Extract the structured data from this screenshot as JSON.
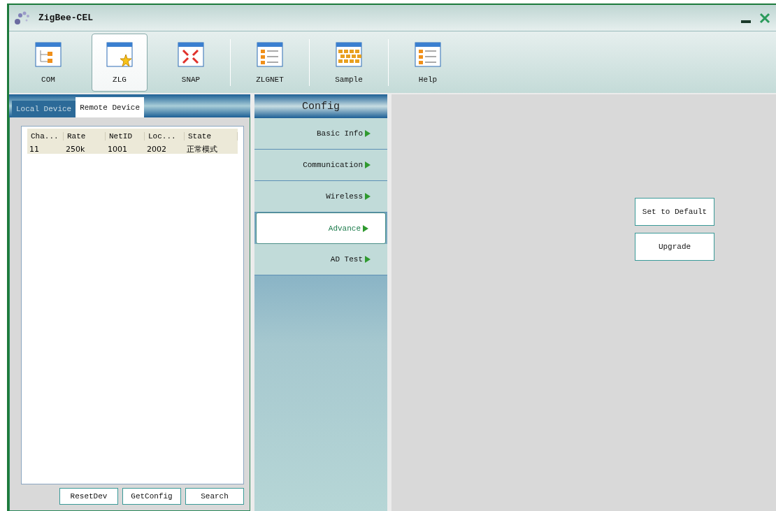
{
  "window": {
    "title": "ZigBee-CEL"
  },
  "toolbar": [
    {
      "label": "COM",
      "kind": "tree",
      "selected": false
    },
    {
      "label": "ZLG",
      "kind": "star",
      "selected": true
    },
    {
      "label": "SNAP",
      "kind": "arrows",
      "selected": false
    },
    {
      "label": "ZLGNET",
      "kind": "list",
      "selected": false
    },
    {
      "label": "Sample",
      "kind": "grid",
      "selected": false
    },
    {
      "label": "Help",
      "kind": "list",
      "selected": false
    }
  ],
  "device_tabs": [
    {
      "label": "Local Device",
      "selected": false
    },
    {
      "label": "Remote Device",
      "selected": true
    }
  ],
  "device_list": {
    "columns": [
      "Cha...",
      "Rate",
      "NetID",
      "Loc...",
      "State"
    ],
    "rows": [
      {
        "cells": [
          "11",
          "250k",
          "1001",
          "2002",
          "正常模式"
        ],
        "selected": true
      }
    ]
  },
  "device_buttons": [
    "ResetDev",
    "GetConfig",
    "Search"
  ],
  "config": {
    "title": "Config",
    "items": [
      {
        "label": "Basic Info",
        "selected": false
      },
      {
        "label": "Communication",
        "selected": false
      },
      {
        "label": "Wireless",
        "selected": false
      },
      {
        "label": "Advance",
        "selected": true
      },
      {
        "label": "AD Test",
        "selected": false
      }
    ]
  },
  "actions": [
    "Set to Default",
    "Upgrade"
  ]
}
